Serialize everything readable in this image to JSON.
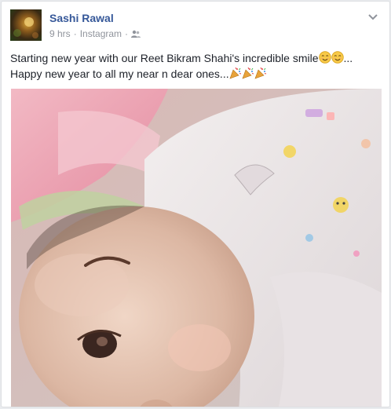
{
  "post": {
    "author_name": "Sashi Rawal",
    "timestamp": "9 hrs",
    "separator": "·",
    "source": "Instagram",
    "privacy_icon": "friends-icon",
    "avatar_icon": "profile-photo",
    "options_icon": "chevron-down-icon",
    "message_line1": "Starting new year with our Reet Bikram Shahi's incredible smile",
    "message_line1_suffix": "...",
    "message_line2": "Happy new year to all my near n dear ones...",
    "emojis_line1": [
      "smiling-face-icon",
      "smiling-face-icon"
    ],
    "emojis_line2": [
      "party-popper-icon",
      "party-popper-icon",
      "party-popper-icon"
    ],
    "photo_subject": "baby in pink blanket and white printed onesie"
  },
  "colors": {
    "author": "#365899",
    "meta": "#90949c",
    "text": "#1d2129",
    "border": "#dddfe2"
  }
}
